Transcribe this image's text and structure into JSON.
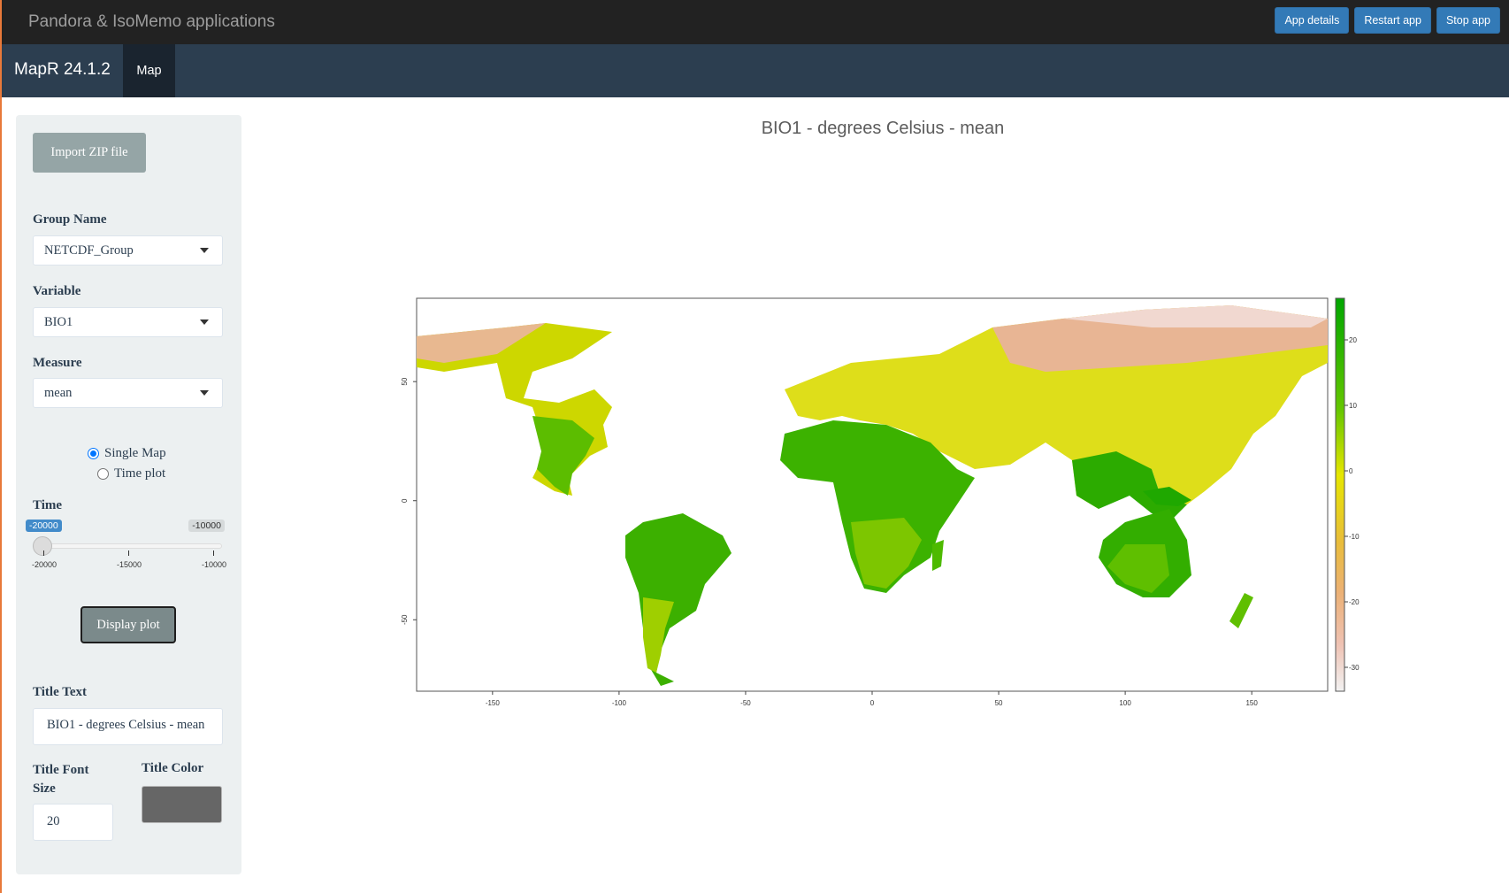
{
  "topbar": {
    "title": "Pandora & IsoMemo applications",
    "buttons": [
      "App details",
      "Restart app",
      "Stop app"
    ]
  },
  "navbar": {
    "brand": "MapR 24.1.2",
    "tab": "Map"
  },
  "sidebar": {
    "import_label": "Import ZIP file",
    "group_label": "Group Name",
    "group_value": "NETCDF_Group",
    "variable_label": "Variable",
    "variable_value": "BIO1",
    "measure_label": "Measure",
    "measure_value": "mean",
    "radio_single": "Single Map",
    "radio_time": "Time plot",
    "time_label": "Time",
    "time_from": "-20000",
    "time_to": "-10000",
    "time_ticks": [
      "-20000",
      "-15000",
      "-10000"
    ],
    "display_label": "Display plot",
    "title_text_label": "Title Text",
    "title_text_value": "BIO1 - degrees Celsius - mean",
    "title_font_label": "Title Font Size",
    "title_font_value": "20",
    "title_color_label": "Title Color",
    "title_color": "#666666"
  },
  "plot": {
    "title": "BIO1 - degrees Celsius - mean",
    "x_ticks": [
      "-150",
      "-100",
      "-50",
      "0",
      "50",
      "100",
      "150"
    ],
    "y_ticks": [
      "-50",
      "0",
      "50"
    ],
    "legend_ticks": [
      "20",
      "10",
      "0",
      "-10",
      "-20",
      "-30"
    ],
    "legend_colors": [
      "#00a600",
      "#63c600",
      "#e6e600",
      "#e9bd3a",
      "#ecb176",
      "#efc2b3",
      "#f2f2f2"
    ]
  }
}
